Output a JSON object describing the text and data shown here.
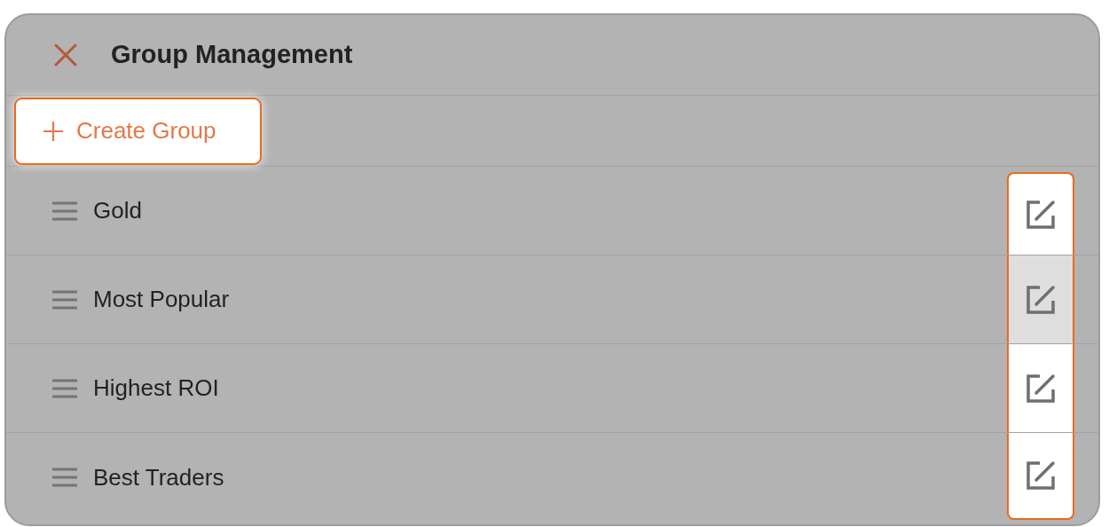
{
  "header": {
    "title": "Group Management"
  },
  "create_button": {
    "label": "Create Group"
  },
  "groups": [
    {
      "name": "Gold",
      "hovered": false
    },
    {
      "name": "Most Popular",
      "hovered": true
    },
    {
      "name": "Highest ROI",
      "hovered": false
    },
    {
      "name": "Best Traders",
      "hovered": false
    }
  ]
}
